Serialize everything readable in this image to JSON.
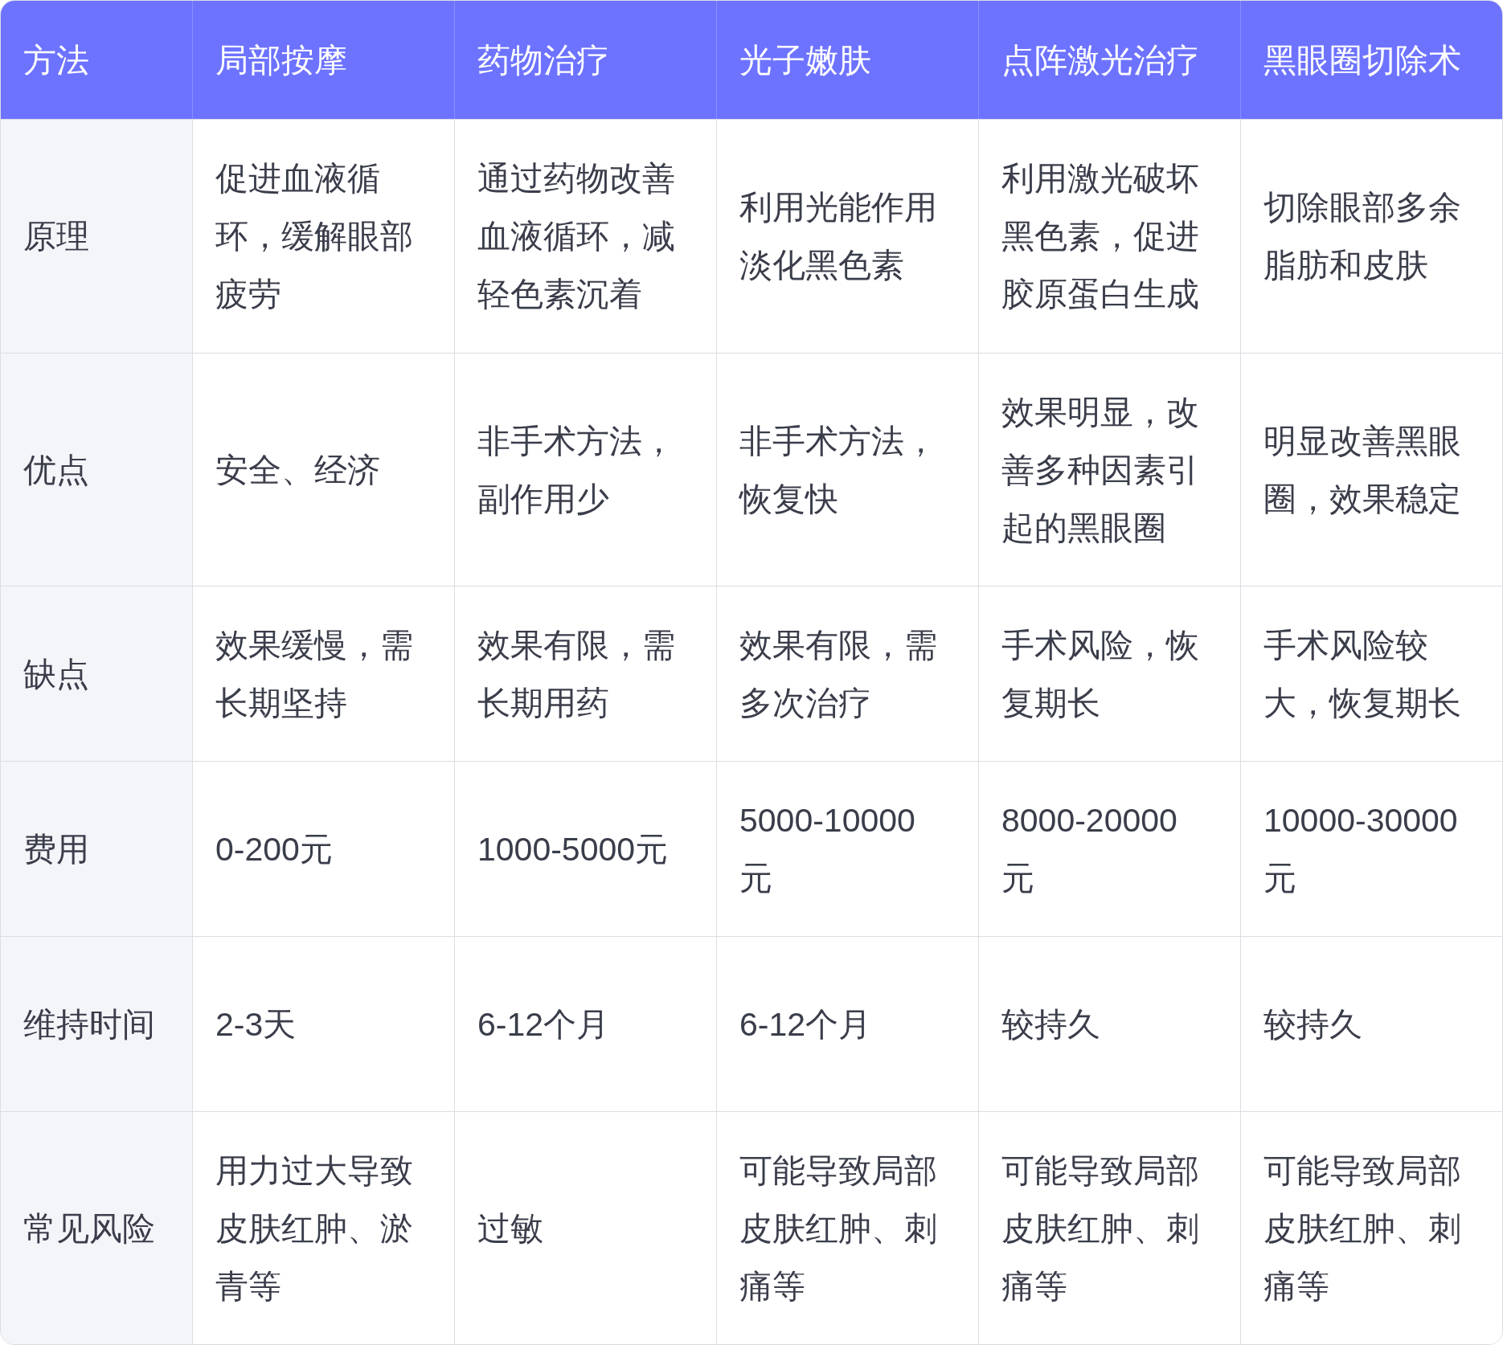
{
  "table": {
    "columns": [
      "方法",
      "局部按摩",
      "药物治疗",
      "光子嫩肤",
      "点阵激光治疗",
      "黑眼圈切除术"
    ],
    "rows": [
      {
        "cells": [
          "原理",
          "促进血液循环，缓解眼部疲劳",
          "通过药物改善血液循环，减轻色素沉着",
          "利用光能作用淡化黑色素",
          "利用激光破坏黑色素，促进胶原蛋白生成",
          "切除眼部多余脂肪和皮肤"
        ]
      },
      {
        "cells": [
          "优点",
          "安全、经济",
          "非手术方法，副作用少",
          "非手术方法，恢复快",
          "效果明显，改善多种因素引起的黑眼圈",
          "明显改善黑眼圈，效果稳定"
        ]
      },
      {
        "cells": [
          "缺点",
          "效果缓慢，需长期坚持",
          "效果有限，需长期用药",
          "效果有限，需多次治疗",
          "手术风险，恢复期长",
          "手术风险较大，恢复期长"
        ]
      },
      {
        "cells": [
          "费用",
          "0-200元",
          "1000-5000元",
          "5000-10000元",
          "8000-20000元",
          "10000-30000元"
        ]
      },
      {
        "cells": [
          "维持时间",
          "2-3天",
          "6-12个月",
          "6-12个月",
          "较持久",
          "较持久"
        ]
      },
      {
        "cells": [
          "常见风险",
          "用力过大导致皮肤红肿、淤青等",
          "过敏",
          "可能导致局部皮肤红肿、刺痛等",
          "可能导致局部皮肤红肿、刺痛等",
          "可能导致局部皮肤红肿、刺痛等"
        ]
      }
    ]
  }
}
